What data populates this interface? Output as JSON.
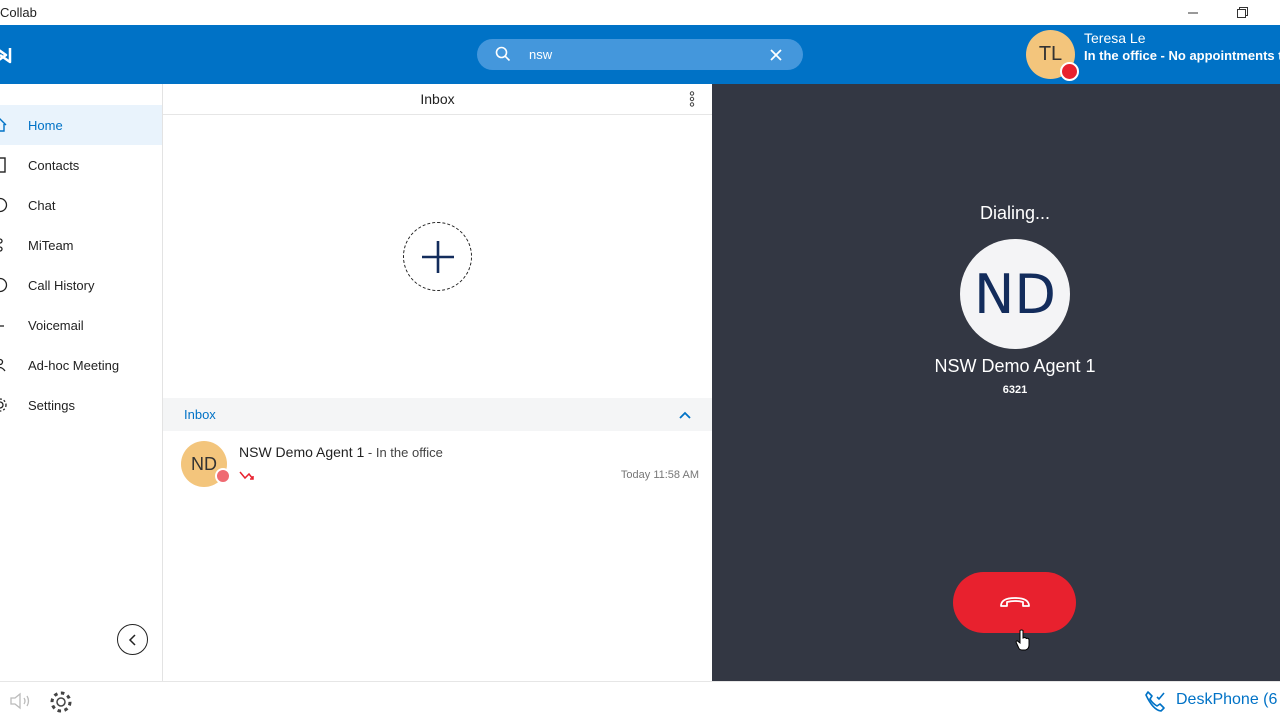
{
  "window": {
    "title": "Collab"
  },
  "header": {
    "search": {
      "value": "nsw"
    },
    "user": {
      "initials": "TL",
      "name": "Teresa Le",
      "status": "In the office - No appointments today"
    }
  },
  "sidebar": {
    "items": [
      {
        "label": "Home",
        "icon": "home-icon",
        "active": true
      },
      {
        "label": "Contacts",
        "icon": "contacts-icon"
      },
      {
        "label": "Chat",
        "icon": "chat-icon"
      },
      {
        "label": "MiTeam",
        "icon": "miteam-icon"
      },
      {
        "label": "Call History",
        "icon": "call-history-icon"
      },
      {
        "label": "Voicemail",
        "icon": "voicemail-icon"
      },
      {
        "label": "Ad-hoc Meeting",
        "icon": "meeting-icon"
      },
      {
        "label": "Settings",
        "icon": "settings-icon"
      }
    ]
  },
  "inbox": {
    "title": "Inbox",
    "section_label": "Inbox",
    "items": [
      {
        "initials": "ND",
        "name": "NSW Demo Agent 1",
        "presence": " - In the office",
        "time": "Today 11:58 AM"
      }
    ]
  },
  "call": {
    "status": "Dialing...",
    "initials": "ND",
    "name": "NSW Demo Agent 1",
    "number": "6321"
  },
  "footer": {
    "device_label": "DeskPhone (6"
  },
  "colors": {
    "brand": "#0072c6",
    "call_bg": "#333743",
    "hangup": "#e8212e",
    "avatar": "#f3c57c"
  }
}
